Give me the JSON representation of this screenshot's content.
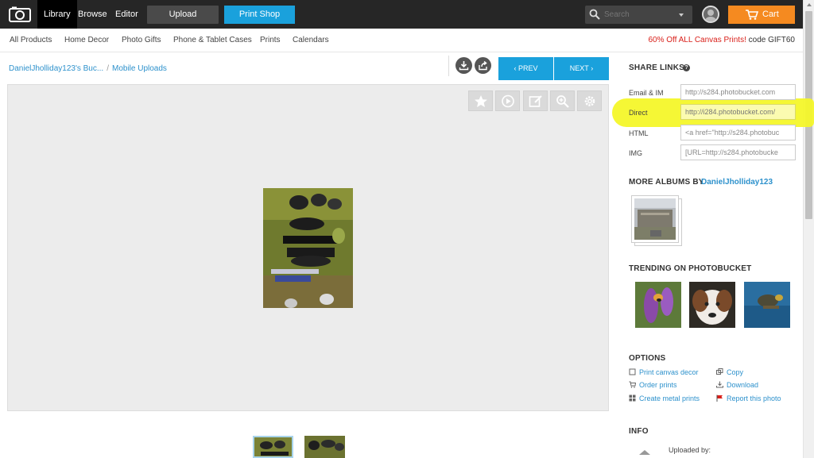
{
  "topbar": {
    "tabs": [
      "Library",
      "Browse",
      "Editor"
    ],
    "upload_label": "Upload",
    "printshop_label": "Print Shop",
    "search_placeholder": "Search",
    "cart_label": "Cart"
  },
  "subnav": {
    "items": [
      "All Products",
      "Home Decor",
      "Photo Gifts",
      "Phone & Tablet Cases",
      "Prints",
      "Calendars"
    ],
    "promo_highlight": "60% Off ALL Canvas Prints!",
    "promo_code": " code GIFT60"
  },
  "breadcrumb": {
    "album": "DanielJholliday123's Buc...",
    "separator": "/",
    "current": "Mobile Uploads"
  },
  "nav": {
    "prev_label": "PREV",
    "next_label": "NEXT"
  },
  "sidebar": {
    "share_title": "SHARE LINKS",
    "help": "?",
    "links": [
      {
        "label": "Email & IM",
        "value": "http://s284.photobucket.com"
      },
      {
        "label": "Direct",
        "value": "http://i284.photobucket.com/"
      },
      {
        "label": "HTML",
        "value": "<a href=\"http://s284.photobuc"
      },
      {
        "label": "IMG",
        "value": "[URL=http://s284.photobucke"
      }
    ],
    "more_albums_title": "MORE ALBUMS BY",
    "more_albums_user": "DanielJholliday123",
    "trending_title": "TRENDING ON PHOTOBUCKET",
    "options_title": "OPTIONS",
    "options": [
      {
        "label": "Print canvas decor",
        "icon": "canvas-icon"
      },
      {
        "label": "Copy",
        "icon": "copy-icon"
      },
      {
        "label": "Order prints",
        "icon": "cart-icon"
      },
      {
        "label": "Download",
        "icon": "download-icon"
      },
      {
        "label": "Create metal prints",
        "icon": "metal-icon"
      },
      {
        "label": "Report this photo",
        "icon": "flag-icon"
      }
    ],
    "info_title": "INFO",
    "uploaded_by": "Uploaded by:"
  },
  "colors": {
    "accent": "#1aa1dc",
    "cart": "#f58a20",
    "topbar": "#262626",
    "promo": "#d9201a",
    "highlight": "#f4f72a"
  }
}
